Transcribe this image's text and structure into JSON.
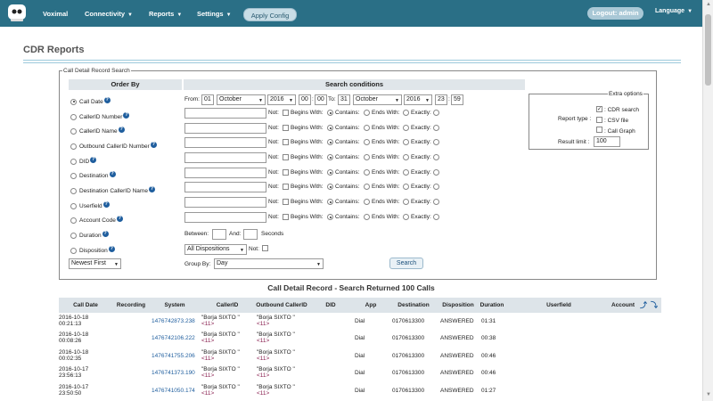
{
  "nav": {
    "brand": "Voximal",
    "connectivity": "Connectivity",
    "reports": "Reports",
    "settings": "Settings",
    "apply": "Apply Config",
    "logout": "Logout: admin",
    "language": "Language"
  },
  "page_title": "CDR Reports",
  "search_legend": "Call Detail Record Search",
  "order_by_header": "Order By",
  "search_header": "Search conditions",
  "order_items": [
    "Call Date",
    "CallerID Number",
    "CallerID Name",
    "Outbound CallerID Number",
    "DID",
    "Destination",
    "Destination CallerID Name",
    "Userfield",
    "Account Code",
    "Duration",
    "Disposition"
  ],
  "date": {
    "from_label": "From:",
    "from_day": "01",
    "from_month": "October",
    "from_year": "2016",
    "from_hour": "00",
    "from_min": "00",
    "to_label": "To:",
    "to_day": "31",
    "to_month": "October",
    "to_year": "2016",
    "to_hour": "23",
    "to_min": "59"
  },
  "cond": {
    "not": "Not:",
    "begins": "Begins With:",
    "contains": "Contains:",
    "ends": "Ends With:",
    "exactly": "Exactly:"
  },
  "duration": {
    "between": "Between:",
    "and": "And:",
    "seconds": "Seconds"
  },
  "disposition": {
    "value": "All Dispositions",
    "not": "Not:"
  },
  "sort": {
    "value": "Newest First"
  },
  "group": {
    "label": "Group By:",
    "value": "Day"
  },
  "extra": {
    "legend": "Extra options",
    "report_type": "Report type :",
    "cdr_search": ": CDR search",
    "csv": ": CSV file",
    "graph": ": Call Graph",
    "limit_label": "Result limit :",
    "limit_value": "100"
  },
  "search_button": "Search",
  "results_title": "Call Detail Record - Search Returned 100 Calls",
  "columns": [
    "Call Date",
    "Recording",
    "System",
    "CallerID",
    "Outbound CallerID",
    "DID",
    "App",
    "Destination",
    "Disposition",
    "Duration",
    "Userfield",
    "Account"
  ],
  "rows": [
    {
      "date": "2016-10-18",
      "time": "00:21:13",
      "system": "1476742873.238",
      "cid1": "\"Borja SIXTO \"",
      "cid2": "<11>",
      "ocid1": "\"Borja SIXTO \"",
      "ocid2": "<11>",
      "app": "Dial",
      "dest": "0170613300",
      "disp": "ANSWERED",
      "dur": "01:31"
    },
    {
      "date": "2016-10-18",
      "time": "00:08:26",
      "system": "1476742106.222",
      "cid1": "\"Borja SIXTO \"",
      "cid2": "<11>",
      "ocid1": "\"Borja SIXTO \"",
      "ocid2": "<11>",
      "app": "Dial",
      "dest": "0170613300",
      "disp": "ANSWERED",
      "dur": "00:38"
    },
    {
      "date": "2016-10-18",
      "time": "00:02:35",
      "system": "1476741755.206",
      "cid1": "\"Borja SIXTO \"",
      "cid2": "<11>",
      "ocid1": "\"Borja SIXTO \"",
      "ocid2": "<11>",
      "app": "Dial",
      "dest": "0170613300",
      "disp": "ANSWERED",
      "dur": "00:46"
    },
    {
      "date": "2016-10-17",
      "time": "23:56:13",
      "system": "1476741373.190",
      "cid1": "\"Borja SIXTO \"",
      "cid2": "<11>",
      "ocid1": "\"Borja SIXTO \"",
      "ocid2": "<11>",
      "app": "Dial",
      "dest": "0170613300",
      "disp": "ANSWERED",
      "dur": "00:46"
    },
    {
      "date": "2016-10-17",
      "time": "23:50:50",
      "system": "1476741050.174",
      "cid1": "\"Borja SIXTO \"",
      "cid2": "<11>",
      "ocid1": "\"Borja SIXTO \"",
      "ocid2": "<11>",
      "app": "Dial",
      "dest": "0170613300",
      "disp": "ANSWERED",
      "dur": "01:27"
    }
  ]
}
